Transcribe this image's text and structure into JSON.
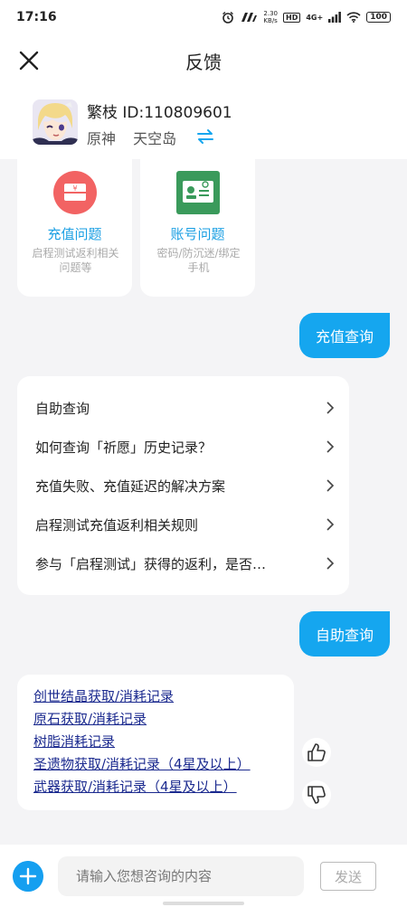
{
  "status_bar": {
    "time": "17:16",
    "net_speed_top": "2.30",
    "net_speed_bottom": "KB/s",
    "hd": "HD",
    "signal": "4G+",
    "battery": "100"
  },
  "header": {
    "title": "反馈"
  },
  "profile": {
    "name_id": "繁枝 ID:110809601",
    "game": "原神",
    "server": "天空岛"
  },
  "categories": [
    {
      "label": "充值问题",
      "desc": "启程测试返利相关问题等",
      "icon": "wallet-icon",
      "color": "#f26363"
    },
    {
      "label": "账号问题",
      "desc": "密码/防沉迷/绑定手机",
      "icon": "id-card-icon",
      "color": "#3a9a5b"
    }
  ],
  "messages": {
    "user_msg_1": "充值查询",
    "user_msg_2": "自助查询"
  },
  "menu": {
    "items": [
      "自助查询",
      "如何查询「祈愿」历史记录？",
      "充值失败、充值延迟的解决方案",
      "启程测试充值返利相关规则",
      "参与「启程测试」获得的返利，是否…"
    ]
  },
  "links": [
    "创世结晶获取/消耗记录",
    "原石获取/消耗记录",
    "树脂消耗记录",
    "圣遗物获取/消耗记录（4星及以上）",
    "武器获取/消耗记录（4星及以上）"
  ],
  "input": {
    "placeholder": "请输入您想咨询的内容",
    "send_label": "发送"
  },
  "colors": {
    "accent": "#15a6ef",
    "link": "#1b2a8f"
  }
}
